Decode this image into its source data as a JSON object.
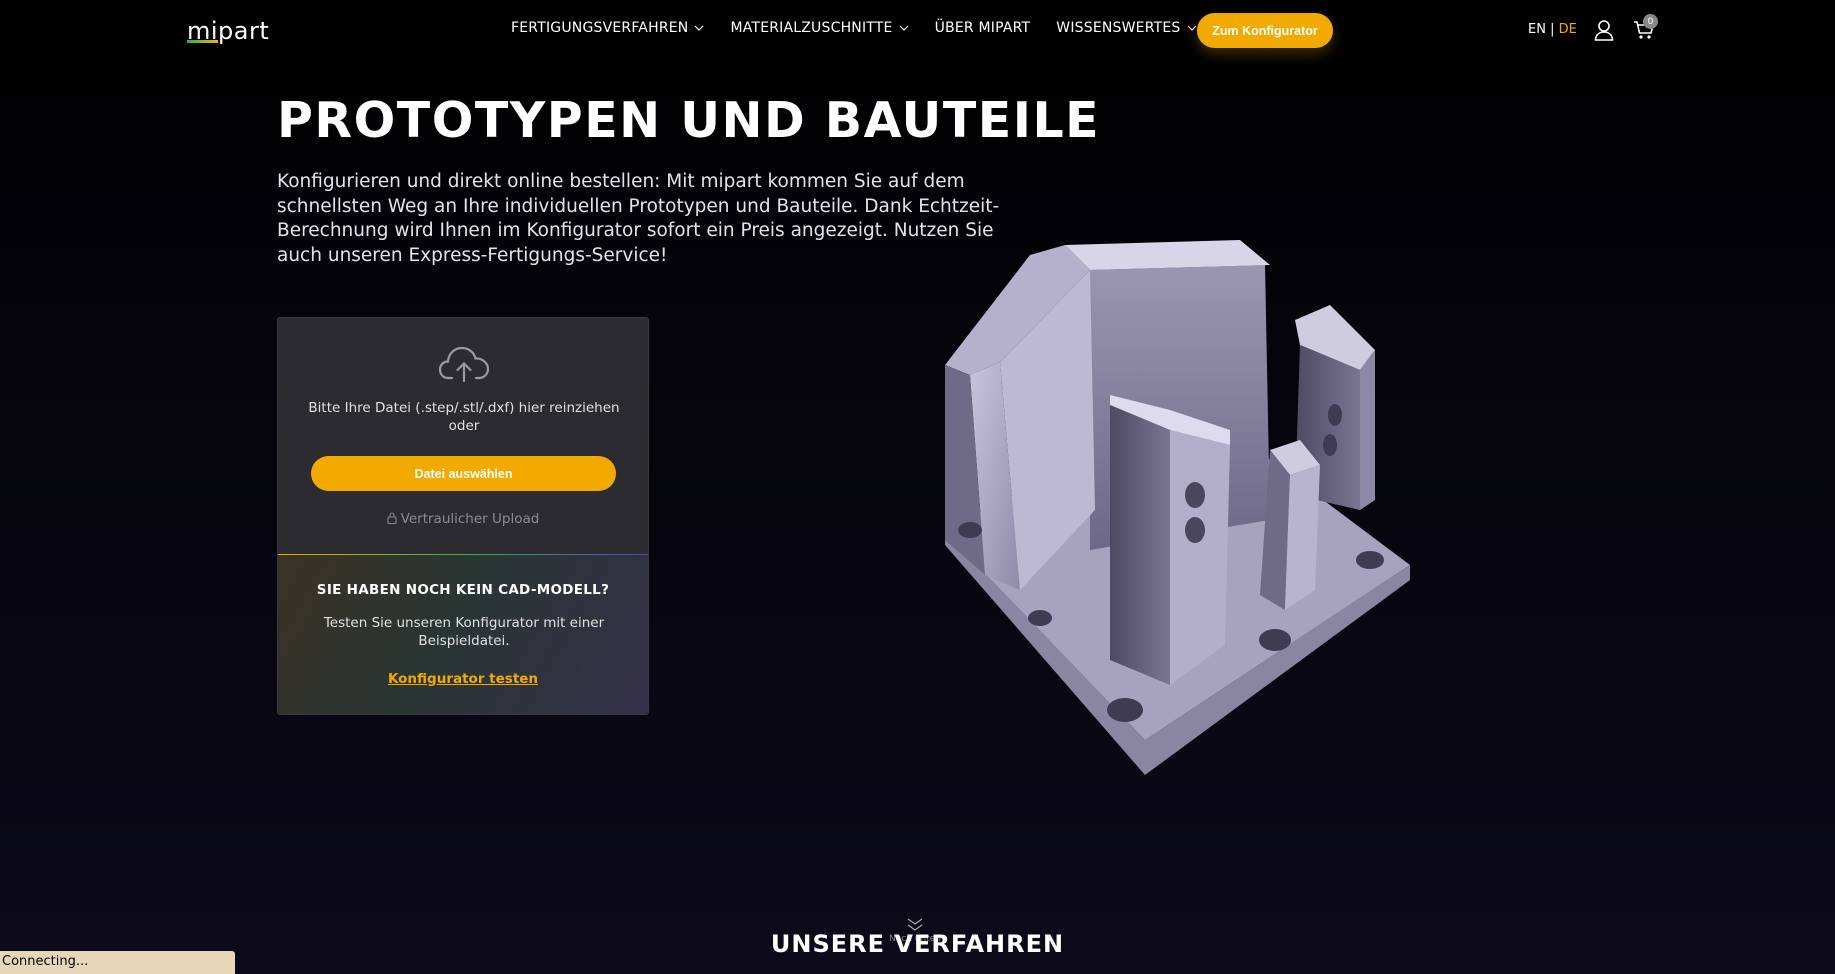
{
  "nav": {
    "logo_mi": "mi",
    "logo_part": "part",
    "menu": [
      {
        "label": "FERTIGUNGSVERFAHREN",
        "has_dropdown": true
      },
      {
        "label": "MATERIALZUSCHNITTE",
        "has_dropdown": true
      },
      {
        "label": "ÜBER MIPART",
        "has_dropdown": false
      },
      {
        "label": "WISSENSWERTES",
        "has_dropdown": true
      }
    ],
    "cta_label": "Zum Konfigurator",
    "lang_en": "EN",
    "lang_sep": " | ",
    "lang_de": "DE",
    "cart_count": "0"
  },
  "hero": {
    "title": "PROTOTYPEN UND BAUTEILE",
    "text": "Konfigurieren und direkt online bestellen: Mit mipart kommen Sie auf dem schnellsten Weg an Ihre individuellen Prototypen und Bauteile. Dank Echtzeit-Berechnung wird Ihnen im Konfigurator sofort ein Preis angezeigt. Nutzen Sie auch unseren Express-Fertigungs-Service!"
  },
  "upload": {
    "drop_text": "Bitte Ihre Datei (.step/.stl/.dxf) hier reinziehen oder",
    "button_label": "Datei auswählen",
    "secure_label": "Vertraulicher Upload"
  },
  "nocad": {
    "title": "SIE HABEN NOCH KEIN CAD-MODELL?",
    "text": "Testen Sie unseren Konfigurator mit einer Beispieldatei.",
    "link_label": "Konfigurator testen"
  },
  "section": {
    "title": "UNSERE VERFAHREN",
    "scroll_label": "Nach unten"
  },
  "status_bar": "Connecting...",
  "colors": {
    "accent": "#f2a900",
    "background": "#000000",
    "card": "#2c2c30"
  }
}
